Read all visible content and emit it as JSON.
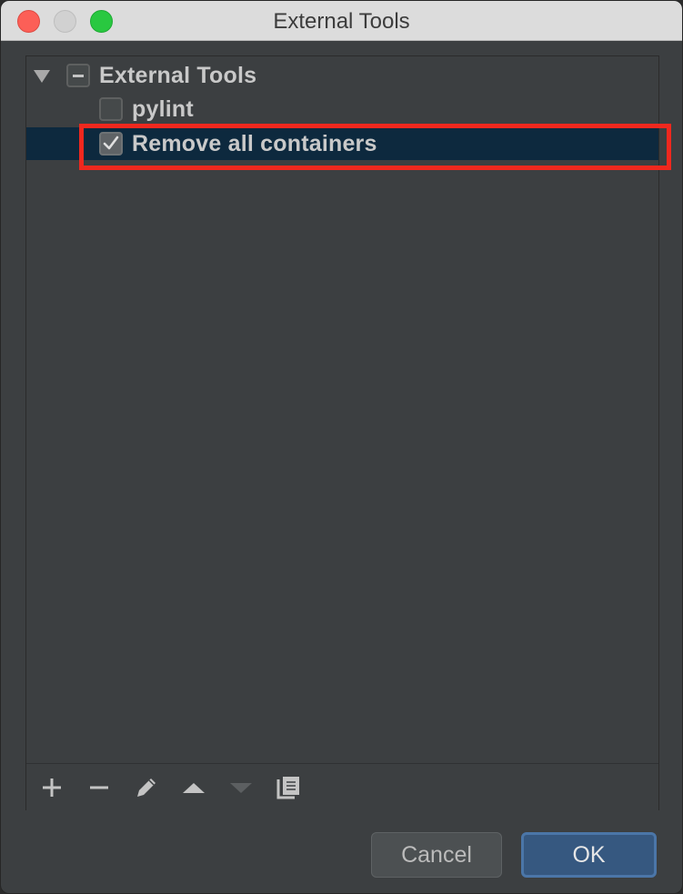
{
  "window": {
    "title": "External Tools"
  },
  "tree": {
    "root": {
      "label": "External Tools",
      "expanded": true,
      "check_state": "partial"
    },
    "items": [
      {
        "label": "pylint",
        "checked": false,
        "selected": false
      },
      {
        "label": "Remove all containers",
        "checked": true,
        "selected": true
      }
    ]
  },
  "toolbar": {
    "buttons": [
      {
        "name": "add",
        "icon": "plus-icon",
        "enabled": true
      },
      {
        "name": "remove",
        "icon": "minus-icon",
        "enabled": true
      },
      {
        "name": "edit",
        "icon": "pencil-icon",
        "enabled": true
      },
      {
        "name": "move-up",
        "icon": "arrow-up-icon",
        "enabled": true
      },
      {
        "name": "move-down",
        "icon": "arrow-down-icon",
        "enabled": false
      },
      {
        "name": "copy",
        "icon": "copy-icon",
        "enabled": true
      }
    ]
  },
  "buttons": {
    "cancel_label": "Cancel",
    "ok_label": "OK"
  },
  "colors": {
    "selection": "#0d293e",
    "annotation_box": "#f0281e",
    "ok_button": "#365880"
  }
}
